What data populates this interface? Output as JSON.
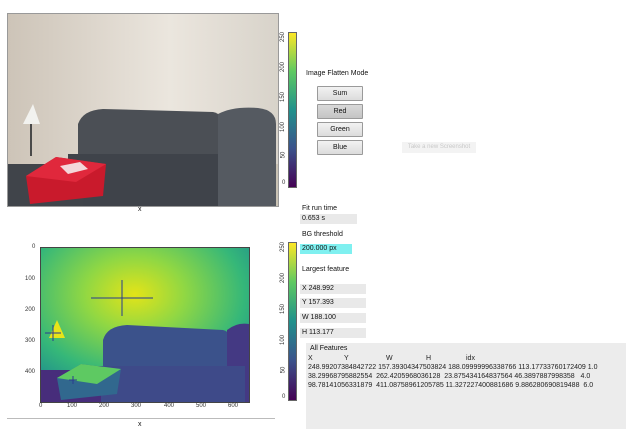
{
  "camera": {
    "axis_label": "x"
  },
  "colorbar_top": {
    "ticks": [
      "250",
      "200",
      "150",
      "100",
      "50",
      "0"
    ]
  },
  "colorbar_bottom": {
    "ticks": [
      "250",
      "200",
      "150",
      "100",
      "50",
      "0"
    ]
  },
  "flatten": {
    "title": "Image Flatten Mode",
    "buttons": [
      "Sum",
      "Red",
      "Green",
      "Blue"
    ],
    "selected": "Red"
  },
  "screenshot_button": "Take a new Screenshot",
  "fit": {
    "label": "Fit run time",
    "value": "0.653 s"
  },
  "bg": {
    "label": "BG threshold",
    "value": "200.000 px"
  },
  "largest": {
    "label": "Largest feature",
    "x": "X  248.992",
    "y": "Y  157.393",
    "w": "W  188.100",
    "h": "H  113.177"
  },
  "features": {
    "label": "All Features",
    "headers": [
      "X",
      "Y",
      "W",
      "H",
      "idx"
    ],
    "rows": [
      "248.99207384842722 157.39304347503824 188.09999996338766 113.17733760172409 1.0",
      "38.29968795882554  262.4205968036128  23.875434164837564 46.3897887998358   4.0",
      "98.78141056331879  411.08758961205785 11.327227400881686 9.886280690819488  6.0"
    ]
  },
  "plot": {
    "xlabel": "x",
    "xticks": [
      "0",
      "100",
      "200",
      "300",
      "400",
      "500",
      "600"
    ],
    "yticks": [
      "0",
      "100",
      "200",
      "300",
      "400"
    ]
  },
  "colors": {
    "viridis_low": "#440154",
    "viridis_mid": "#21918c",
    "viridis_high": "#fde725",
    "highlight_field": "#7ff0f0",
    "crosshair": "#2a3b8f"
  }
}
